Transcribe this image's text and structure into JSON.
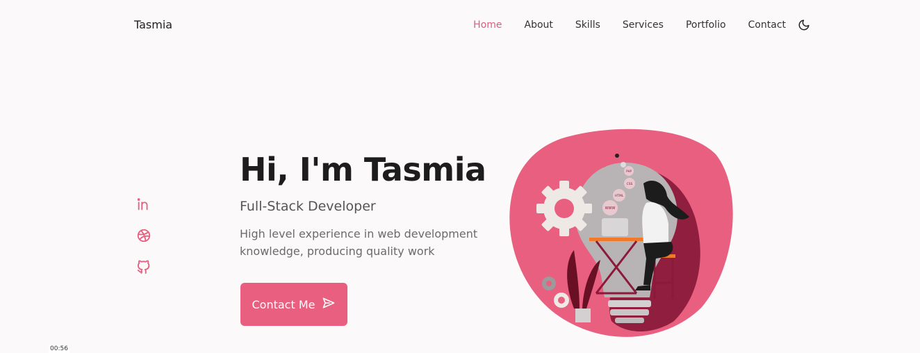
{
  "nav": {
    "logo": "Tasmia",
    "links": [
      "Home",
      "About",
      "Skills",
      "Services",
      "Portfolio",
      "Contact"
    ],
    "active_link": "Home",
    "theme_icon": "moon-icon"
  },
  "social": [
    "linkedin-icon",
    "dribbble-icon",
    "github-icon"
  ],
  "hero": {
    "title": "Hi, I'm Tasmia",
    "subtitle": "Full-Stack Developer",
    "description": "High level experience in web development knowledge, producing quality work",
    "button_label": "Contact Me",
    "button_icon": "send-icon",
    "illustration_labels": [
      "WWW",
      "HTML",
      "CSS",
      "PHP"
    ]
  },
  "video": {
    "timestamp": "00:56"
  },
  "colors": {
    "accent": "#e85f80",
    "active_link": "#d9607e",
    "blob": "#e85f80",
    "blob_dark": "#8b1a3a",
    "background": "#fbf9fa"
  }
}
